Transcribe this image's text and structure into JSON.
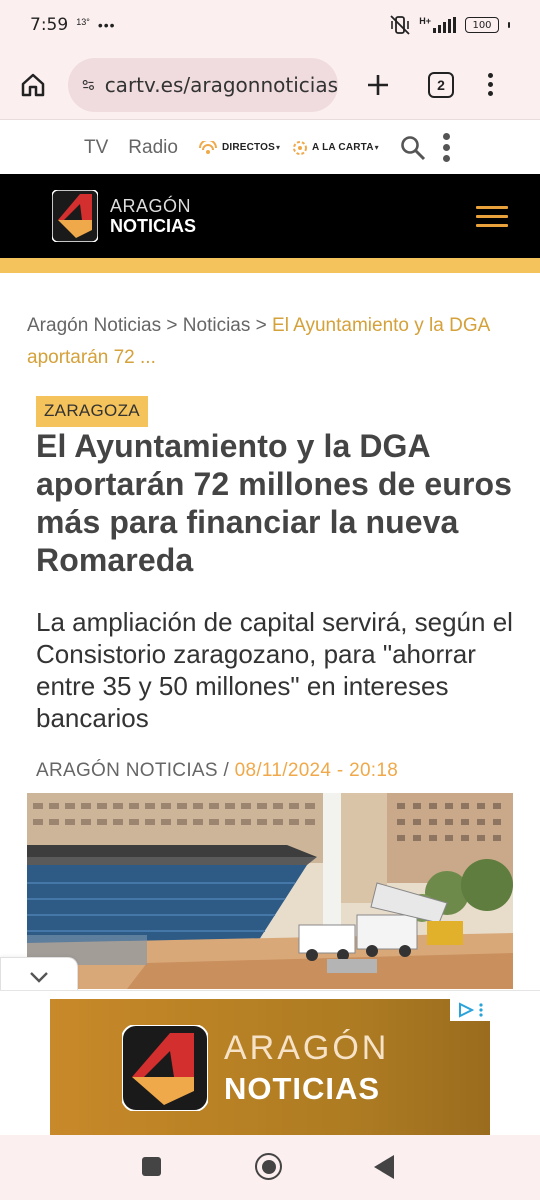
{
  "status_bar": {
    "time": "7:59",
    "temperature": "13°",
    "more": "•••",
    "network": "H+",
    "battery": "100"
  },
  "browser": {
    "url": "cartv.es/aragonnoticias",
    "tab_count": "2"
  },
  "topnav": {
    "tv": "TV",
    "radio": "Radio",
    "directos": "DIRECTOS",
    "a_la_carta": "A LA CARTA"
  },
  "header": {
    "logo_line1": "ARAGÓN",
    "logo_line2": "NOTICIAS"
  },
  "breadcrumb": {
    "home": "Aragón Noticias",
    "sep1": " > ",
    "section": "Noticias",
    "sep2": " > ",
    "current": "El Ayuntamiento y la DGA aportarán 72 ..."
  },
  "article": {
    "tag": "ZARAGOZA",
    "headline": "El Ayuntamiento y la DGA aportarán 72 millones de euros más para financiar la nueva Romareda",
    "subheadline": "La ampliación de capital servirá, según el Consistorio zaragozano, para \"ahorrar entre 35 y 50 millones\" en intereses bancarios",
    "author": "ARAGÓN NOTICIAS",
    "byline_sep": " / ",
    "date": "08/11/2024 - 20:18"
  },
  "ad": {
    "line1": "ARAGÓN",
    "line2": "NOTICIAS"
  },
  "colors": {
    "accent_yellow": "#f4c35b",
    "date_orange": "#f0a94a",
    "header_black": "#000000",
    "hamburger_orange": "#e9a23b"
  }
}
